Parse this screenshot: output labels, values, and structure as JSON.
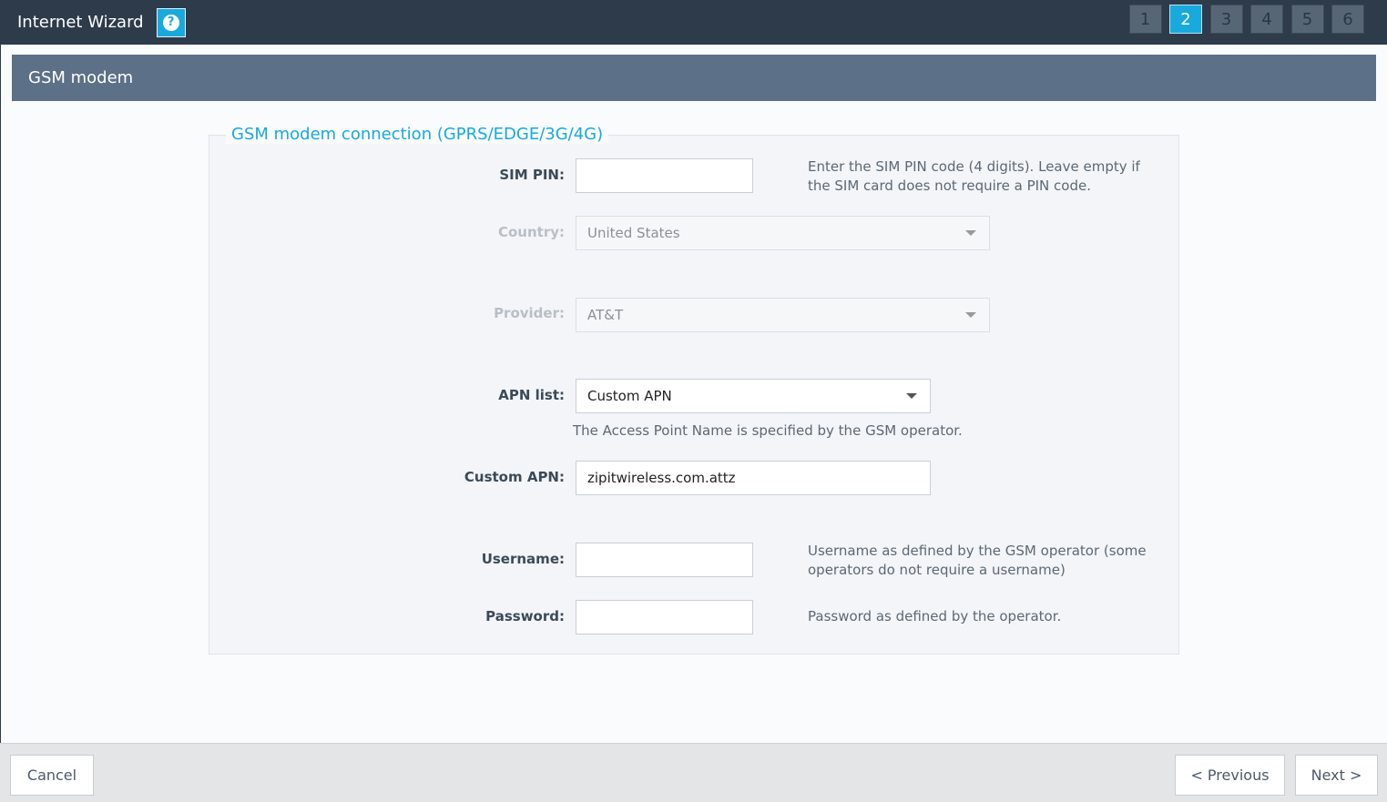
{
  "header": {
    "title": "Internet Wizard",
    "help_icon": "question-circle-icon",
    "steps": [
      "1",
      "2",
      "3",
      "4",
      "5",
      "6"
    ],
    "active_step": "2"
  },
  "section": {
    "title": "GSM modem"
  },
  "fieldset": {
    "legend": "GSM modem connection (GPRS/EDGE/3G/4G)",
    "sim_pin": {
      "label": "SIM PIN:",
      "value": "",
      "hint": "Enter the SIM PIN code (4 digits). Leave empty if the SIM card does not require a PIN code."
    },
    "country": {
      "label": "Country:",
      "selected": "United States"
    },
    "provider": {
      "label": "Provider:",
      "selected": "AT&T"
    },
    "apn_list": {
      "label": "APN list:",
      "selected": "Custom APN",
      "hint": "The Access Point Name is specified by the GSM operator."
    },
    "custom_apn": {
      "label": "Custom APN:",
      "value": "zipitwireless.com.attz"
    },
    "username": {
      "label": "Username:",
      "value": "",
      "hint": "Username as defined by the GSM operator (some operators do not require a username)"
    },
    "password": {
      "label": "Password:",
      "value": "",
      "hint": "Password as defined by the operator."
    }
  },
  "footer": {
    "cancel_label": "Cancel",
    "previous_label": "< Previous",
    "next_label": "Next >"
  },
  "colors": {
    "topbar": "#2d3b4a",
    "accent": "#18a9dd",
    "section_header": "#5c7087"
  }
}
